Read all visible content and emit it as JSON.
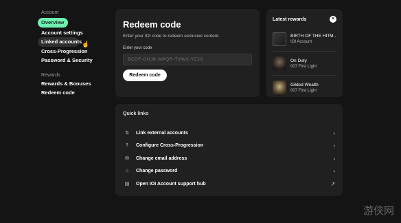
{
  "sidebar": {
    "account_label": "Account",
    "account_items": [
      {
        "label": "Overview"
      },
      {
        "label": "Account settings"
      },
      {
        "label": "Linked accounts"
      },
      {
        "label": "Cross-Progression"
      },
      {
        "label": "Password & Security"
      }
    ],
    "rewards_label": "Rewards",
    "rewards_items": [
      {
        "label": "Rewards & Bonuses"
      },
      {
        "label": "Redeem code"
      }
    ]
  },
  "redeem": {
    "title": "Redeem code",
    "description": "Enter your IOI code to redeem exclusive content.",
    "input_label": "Enter your code",
    "input_placeholder": "BCDF-GHJK-MPQR-TVWX-YZ23",
    "button_label": "Redeem code"
  },
  "latest": {
    "title": "Latest rewards",
    "items": [
      {
        "title": "BIRTH OF THE HITM...",
        "subtitle": "IOI Account"
      },
      {
        "title": "On Duty",
        "subtitle": "007 First Light"
      },
      {
        "title": "Gilded Wealth",
        "subtitle": "007 First Light"
      }
    ]
  },
  "quick_links": {
    "title": "Quick links",
    "items": [
      {
        "label": "Link external accounts",
        "icon": "link-icon"
      },
      {
        "label": "Configure Cross-Progression",
        "icon": "progression-icon"
      },
      {
        "label": "Change email address",
        "icon": "mail-icon"
      },
      {
        "label": "Change password",
        "icon": "lock-icon"
      },
      {
        "label": "Open IOI Account support hub",
        "icon": "document-icon"
      }
    ]
  },
  "colors": {
    "accent": "#6ff0b0",
    "background": "#141414",
    "card": "#202020"
  },
  "watermark": "游侠网"
}
